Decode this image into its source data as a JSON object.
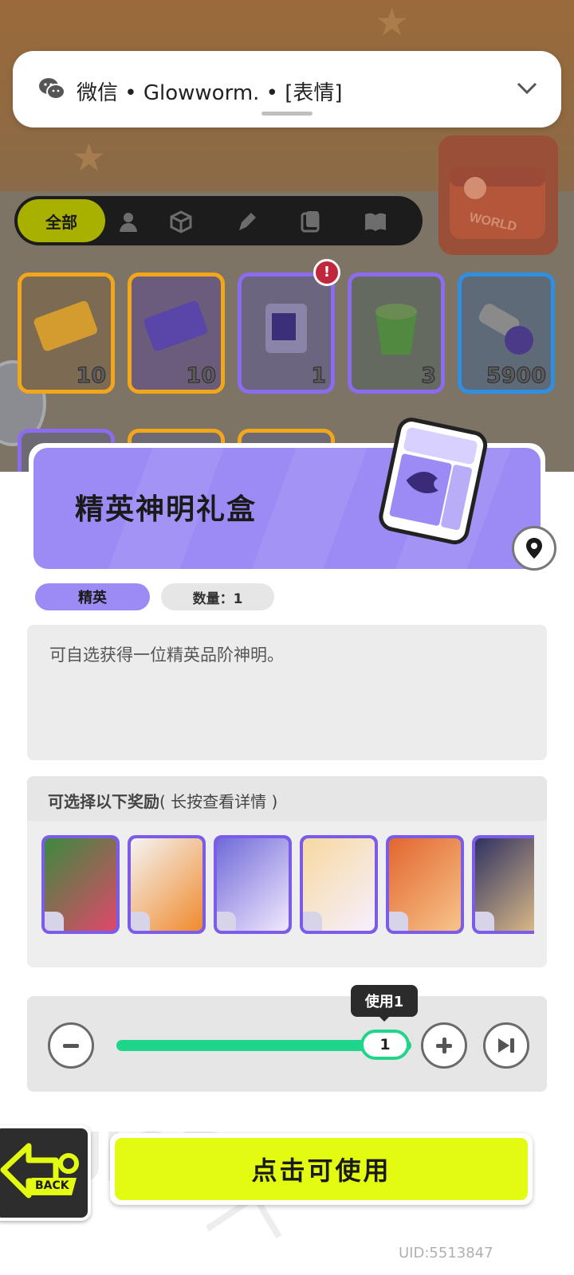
{
  "notification": {
    "app": "微信",
    "sender": "Glowworm.",
    "message": "[表情]",
    "text": "微信 • Glowworm. • [表情]"
  },
  "inventory": {
    "filter_tabs": [
      {
        "label": "全部",
        "active": true
      },
      {
        "icon": "person-icon"
      },
      {
        "icon": "box-icon"
      },
      {
        "icon": "pen-icon"
      },
      {
        "icon": "card-icon"
      },
      {
        "icon": "book-icon"
      }
    ],
    "items": [
      {
        "count": "10",
        "border": "#f2a71b"
      },
      {
        "count": "10",
        "border": "#f2a71b"
      },
      {
        "count": "1",
        "border": "#8b6cf0",
        "alert": "!"
      },
      {
        "count": "3",
        "border": "#8b6cf0"
      },
      {
        "count": "5900",
        "border": "#2f8fe0"
      }
    ],
    "world_label": "WORLD"
  },
  "detail": {
    "title": "精英神明礼盒",
    "rarity": "精英",
    "quantity": "数量：1",
    "description": "可自选获得一位精英品阶神明。",
    "rewards_title": "可选择以下奖励",
    "rewards_hint": "( 长按查看详情 )"
  },
  "rewards": [
    {
      "colors": [
        "#3b8a3e",
        "#e0486a"
      ]
    },
    {
      "colors": [
        "#f4f4f4",
        "#f08a2c"
      ]
    },
    {
      "colors": [
        "#6f6bd8",
        "#f2e8ff"
      ]
    },
    {
      "colors": [
        "#f7d9a0",
        "#f6f0ff"
      ]
    },
    {
      "colors": [
        "#e2662f",
        "#f7c48a"
      ]
    },
    {
      "colors": [
        "#2f3262",
        "#e7c38a"
      ]
    }
  ],
  "usage": {
    "value": "1",
    "tooltip": "使用1",
    "min": 1,
    "max": 1
  },
  "actions": {
    "back_label": "BACK",
    "use_label": "点击可使用"
  },
  "footer": {
    "uid": "UID:5513847"
  },
  "colors": {
    "accent_purple": "#9c8af5",
    "use_yellow": "#e2fb11",
    "slider_green": "#1fd58a"
  }
}
